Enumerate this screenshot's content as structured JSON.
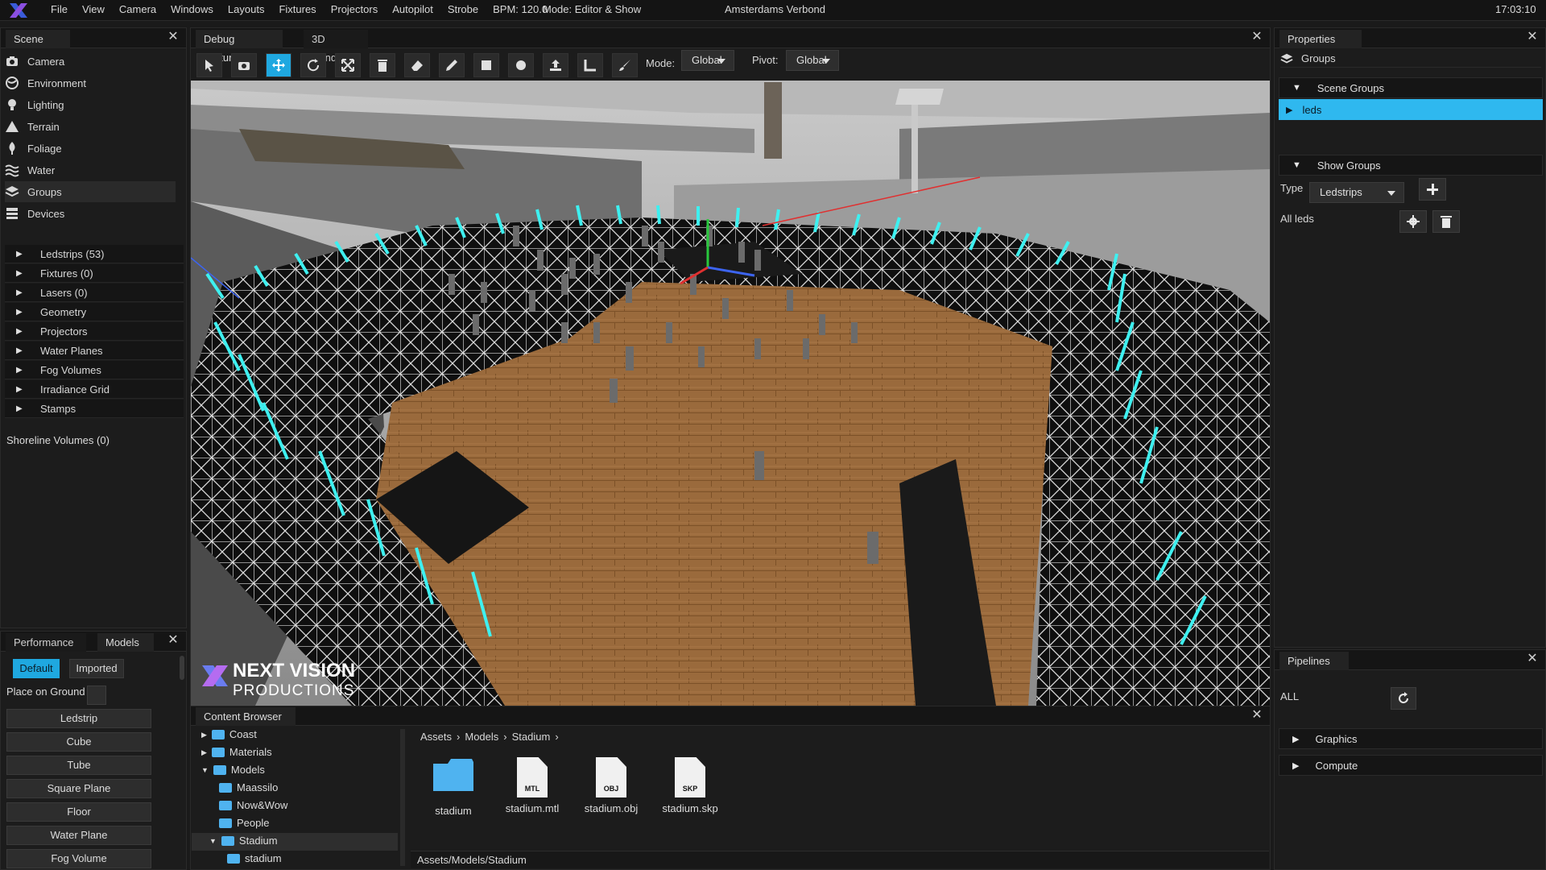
{
  "app": {
    "name": "X",
    "mode_text": "Mode: Editor & Show",
    "project": "Amsterdams Verbond",
    "clock": "17:03:10"
  },
  "menu": {
    "file": "File",
    "view": "View",
    "camera": "Camera",
    "windows": "Windows",
    "layouts": "Layouts",
    "fixtures": "Fixtures",
    "projectors": "Projectors",
    "autopilot": "Autopilot",
    "strobe": "Strobe",
    "bpm": "BPM:  120.0"
  },
  "scene_panel": {
    "tab": "Scene",
    "items": [
      "Camera",
      "Environment",
      "Lighting",
      "Terrain",
      "Foliage",
      "Water",
      "Groups",
      "Devices"
    ],
    "tree": [
      "Ledstrips (53)",
      "Fixtures (0)",
      "Lasers (0)",
      "Geometry",
      "Projectors",
      "Water Planes",
      "Fog Volumes",
      "Irradiance Grid",
      "Stamps"
    ],
    "shoreline": "Shoreline Volumes (0)"
  },
  "models_panel": {
    "tab_performance": "Performance",
    "tab_models": "Models",
    "default_btn": "Default",
    "imported_btn": "Imported",
    "place_on_ground": "Place on Ground",
    "buttons": [
      "Ledstrip",
      "Cube",
      "Tube",
      "Square Plane",
      "Floor",
      "Water Plane",
      "Fog Volume"
    ]
  },
  "viewport": {
    "tab_debug": "Debug Textures",
    "tab_render": "3D Render",
    "mode_label": "Mode:",
    "mode_value": "Global",
    "pivot_label": "Pivot:",
    "pivot_value": "Global",
    "watermark_line1": "NEXT VISION",
    "watermark_line2": "PRODUCTIONS"
  },
  "content_browser": {
    "tab": "Content Browser",
    "tree": [
      "Coast",
      "Materials",
      "Models",
      "Maassilo",
      "Now&Wow",
      "People",
      "Stadium",
      "stadium"
    ],
    "breadcrumb": [
      "Assets",
      "Models",
      "Stadium"
    ],
    "files": [
      {
        "name": "stadium",
        "type": "folder"
      },
      {
        "name": "stadium.mtl",
        "badge": "MTL"
      },
      {
        "name": "stadium.obj",
        "badge": "OBJ"
      },
      {
        "name": "stadium.skp",
        "badge": "SKP"
      }
    ],
    "path": "Assets/Models/Stadium"
  },
  "properties_panel": {
    "tab": "Properties",
    "groups_label": "Groups",
    "scene_groups": "Scene Groups",
    "leds_item": "leds",
    "show_groups": "Show Groups",
    "type_label": "Type",
    "type_value": "Ledstrips",
    "all_leds": "All leds"
  },
  "pipelines_panel": {
    "tab": "Pipelines",
    "all_label": "ALL",
    "graphics": "Graphics",
    "compute": "Compute"
  },
  "colors": {
    "accent": "#1fa8e0",
    "selected_row": "#2fb8ef",
    "floor": "#9a6a3c",
    "led": "#3ef0f0"
  }
}
